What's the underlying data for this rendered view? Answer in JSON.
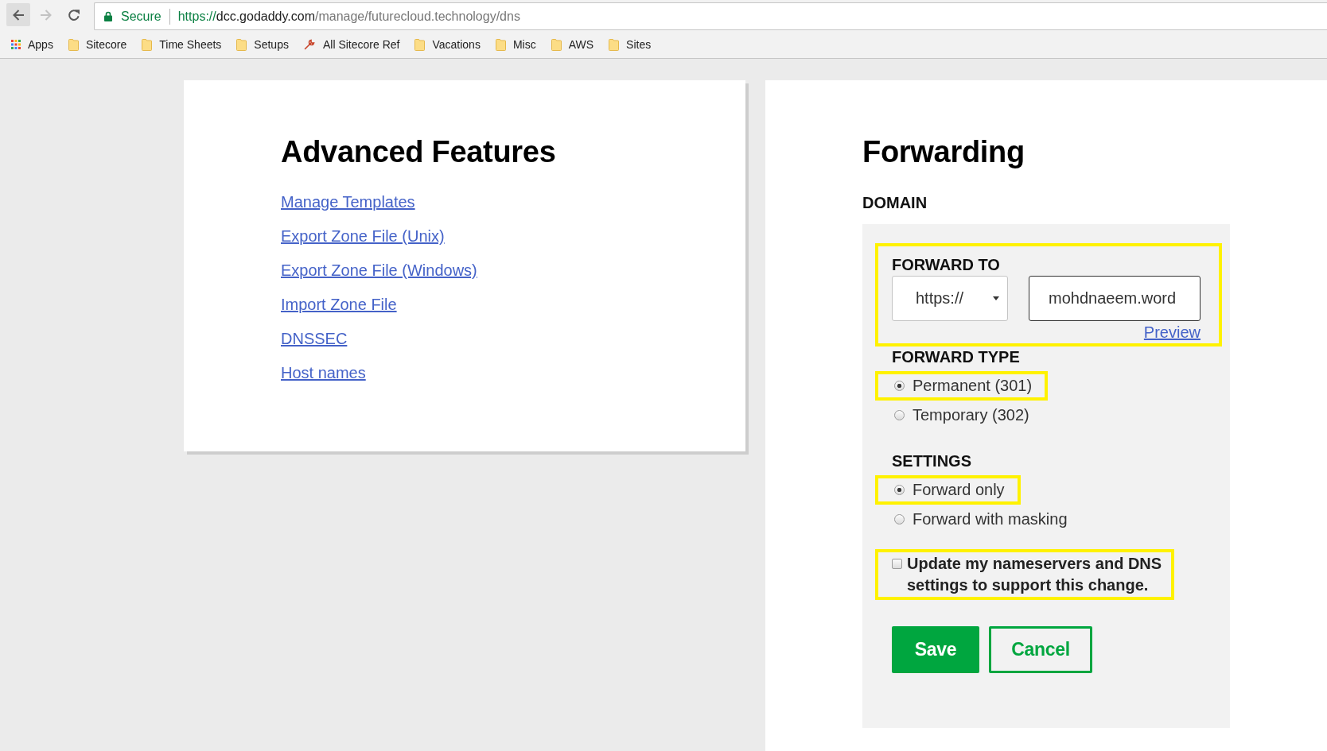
{
  "browser": {
    "nav_buttons": [
      {
        "kind": "back",
        "disabled": false,
        "hovered": true
      },
      {
        "kind": "forward",
        "disabled": true,
        "hovered": false
      },
      {
        "kind": "reload",
        "disabled": false,
        "hovered": false
      }
    ],
    "address_bar": {
      "security_label": "Secure",
      "url": {
        "scheme": "https://",
        "host": "dcc.godaddy.com",
        "path": "/manage/futurecloud.technology/dns"
      }
    },
    "bookmarks": [
      {
        "label": "Apps",
        "kind": "apps"
      },
      {
        "label": "Sitecore",
        "kind": "folder"
      },
      {
        "label": "Time Sheets",
        "kind": "folder"
      },
      {
        "label": "Setups",
        "kind": "folder"
      },
      {
        "label": "All Sitecore Ref",
        "kind": "link"
      },
      {
        "label": "Vacations",
        "kind": "folder"
      },
      {
        "label": "Misc",
        "kind": "folder"
      },
      {
        "label": "AWS",
        "kind": "folder"
      },
      {
        "label": "Sites",
        "kind": "folder"
      }
    ]
  },
  "advanced_features": {
    "title": "Advanced Features",
    "links": [
      "Manage Templates",
      "Export Zone File (Unix)",
      "Export Zone File (Windows)",
      "Import Zone File",
      "DNSSEC",
      "Host names"
    ]
  },
  "forwarding": {
    "title": "Forwarding",
    "section": "DOMAIN",
    "forward_to": {
      "label": "FORWARD TO",
      "highlighted": true,
      "protocol": "https://",
      "destination": "mohdnaeem.word",
      "preview_link": "Preview"
    },
    "forward_type": {
      "label": "FORWARD TYPE",
      "options": [
        {
          "label": "Permanent (301)",
          "selected": true,
          "highlighted": true
        },
        {
          "label": "Temporary (302)",
          "selected": false,
          "highlighted": false
        }
      ]
    },
    "settings": {
      "label": "SETTINGS",
      "options": [
        {
          "label": "Forward only",
          "selected": true,
          "highlighted": true
        },
        {
          "label": "Forward with masking",
          "selected": false,
          "highlighted": false
        }
      ]
    },
    "update_nameservers": {
      "label": "Update my nameservers and DNS settings to support this change.",
      "checked": false,
      "highlighted": true
    },
    "buttons": [
      {
        "label": "Save",
        "kind": "save"
      },
      {
        "label": "Cancel",
        "kind": "cancel"
      }
    ]
  }
}
